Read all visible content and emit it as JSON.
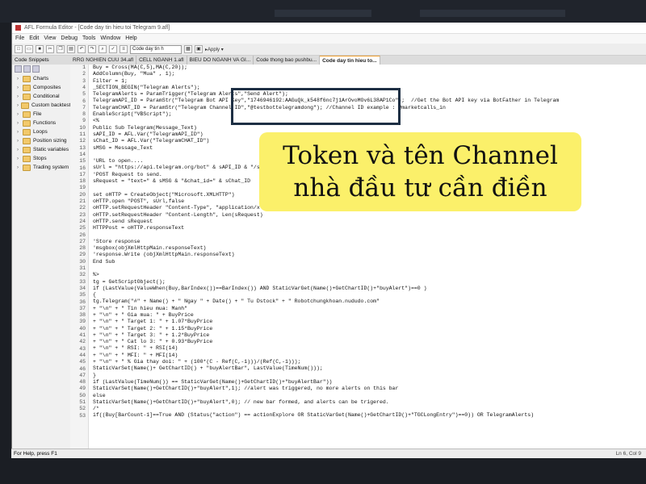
{
  "window": {
    "title": "AFL Formula Editor - [Code day tin hieu toi Telegram 9.afl]",
    "menu": [
      "File",
      "Edit",
      "View",
      "Debug",
      "Tools",
      "Window",
      "Help"
    ],
    "toolbar_combo": "Code day tin h",
    "toolbar_apply": "Apply"
  },
  "sidebar": {
    "header": "Code Snippets",
    "items": [
      {
        "label": "Charts"
      },
      {
        "label": "Composites"
      },
      {
        "label": "Conditional"
      },
      {
        "label": "Custom backtest"
      },
      {
        "label": "File"
      },
      {
        "label": "Functions"
      },
      {
        "label": "Loops"
      },
      {
        "label": "Position sizing"
      },
      {
        "label": "Static variables"
      },
      {
        "label": "Stops"
      },
      {
        "label": "Trading system"
      }
    ]
  },
  "tabs": [
    {
      "label": "RRG NGHIEN CUU 34.afl"
    },
    {
      "label": "CELL NGANH 1.afl"
    },
    {
      "label": "BIEU DO NGANH VA GI..."
    },
    {
      "label": "Code thong bao pushbu..."
    },
    {
      "label": "Code day tin hieu to..."
    }
  ],
  "code": {
    "lines": [
      "Buy = Cross(MA(C,5),MA(C,20));",
      "AddColumn(Buy, \"Mua\" , 1);",
      "Filter = 1;",
      "_SECTION_BEGIN(\"Telegram Alerts\");",
      "TelegramAlerts = ParamTrigger(\"Telegram Alerts\",\"Send Alert\");",
      "TelegramAPI_ID = ParamStr(\"Telegram Bot API Key\",\"1746946192:AAGuQk_k548f6nc7j1ArOvoMOv6L38AP1Co\");  //Get the Bot API key via BotFather in Telegram",
      "TelegramCHAT_ID = ParamStr(\"Telegram Channel ID\",\"@testbottelegramdong\"); //Channel ID example : @marketcalls_in",
      "EnableScript(\"VBScript\");",
      "<%",
      "Public Sub Telegram(Message_Text)",
      "sAPI_ID = AFL.Var(\"TelegramAPI_ID\")",
      "sChat_ID = AFL.Var(\"TelegramCHAT_ID\")",
      "sMSG = Message_Text",
      "",
      "'URL to open....",
      "sUrl = \"https://api.telegram.org/bot\" & sAPI_ID & \"/sendMessage?chat_id=\"",
      "'POST Request to send.",
      "sRequest = \"text=\" & sMSG & \"&chat_id=\" & sChat_ID",
      "",
      "set oHTTP = CreateObject(\"Microsoft.XMLHTTP\")",
      "oHTTP.open \"POST\", sUrl,false",
      "oHTTP.setRequestHeader \"Content-Type\", \"application/x-www-form-urlencoded\"",
      "oHTTP.setRequestHeader \"Content-Length\", Len(sRequest)",
      "oHTTP.send sRequest",
      "HTTPPost = oHTTP.responseText",
      "",
      "'Store response",
      "'msgbox(objXmlHttpMain.responseText)",
      "'response.Write (objXmlHttpMain.responseText)",
      "End Sub",
      "",
      "%>",
      "tg = GetScriptObject();",
      "if (LastValue(ValueWhen(Buy,BarIndex())==BarIndex()) AND StaticVarGet(Name()+GetChartID()+\"buyAlert\")==0 )",
      "{",
      "tg.Telegram(\"#\" + Name() + \" Ngay \" + Date() + \" Tu Dstock\" + \" Robotchungkhoan.nududo.com\"",
      "+ \"\\n\" + \" Tin hieu mua: Manh\"",
      "+ \"\\n\" + \" Gia mua: \" + BuyPrice",
      "+ \"\\n\" + \" Target 1: \" + 1.07*BuyPrice",
      "+ \"\\n\" + \" Target 2: \" + 1.15*BuyPrice",
      "+ \"\\n\" + \" Target 3: \" + 1.2*BuyPrice",
      "+ \"\\n\" + \" Cat lo 3: \" + 0.93*BuyPrice",
      "+ \"\\n\" + \" RSI: \" + RSI(14)",
      "+ \"\\n\" + \" MFI: \" + MFI(14)",
      "+ \"\\n\" + \" % Gia thay doi: \" + (100*(C - Ref(C,-1)))/(Ref(C,-1)));",
      "StaticVarSet(Name()+ GetChartID() + \"buyAlertBar\", LastValue(TimeNum()));",
      "}",
      "if (LastValue(TimeNum()) == StaticVarGet(Name()+GetChartID()+\"buyAlertBar\"))",
      "StaticVarSet(Name()+GetChartID()+\"buyAlert\",1); //alert was triggered, no more alerts on this bar",
      "else",
      "StaticVarSet(Name()+GetChartID()+\"buyAlert\",0); // new bar formed, and alerts can be trigered.",
      "/*",
      "if((Buy[BarCount-1]==True AND (Status(\"action\") == actionExplore OR StaticVarGet(Name()+GetChartID()+\"TGCLongEntry\")==0)) OR TelegramAlerts)"
    ]
  },
  "callout": {
    "line1": "Token và tên Channel",
    "line2": "nhà đầu tư cần điền"
  },
  "status": {
    "left": "For Help, press F1",
    "right": "Ln 6, Col 9"
  }
}
